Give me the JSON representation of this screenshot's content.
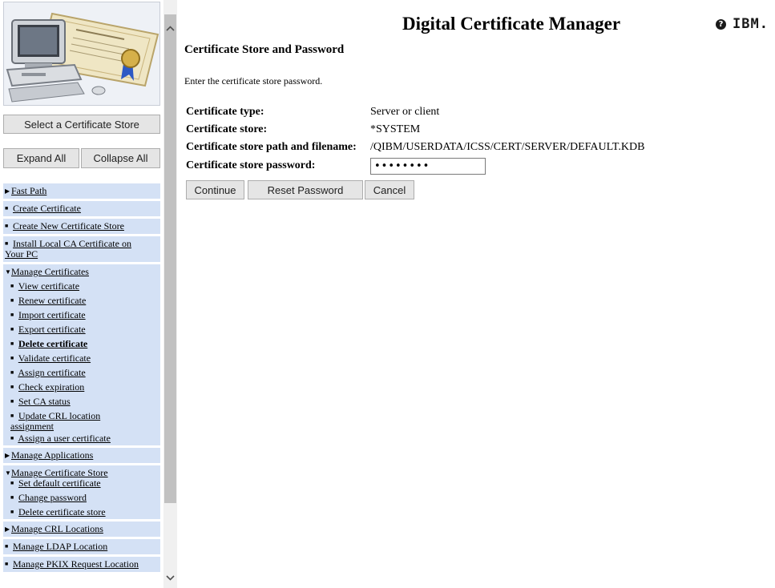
{
  "sidebar": {
    "select_store_label": "Select a Certificate Store",
    "expand_all_label": "Expand All",
    "collapse_all_label": "Collapse All",
    "fast_path": "Fast Path",
    "create_certificate": "Create Certificate",
    "create_new_store": "Create New Certificate Store",
    "install_local_ca_line1": "Install Local CA Certificate on",
    "install_local_ca_line2": "Your PC",
    "manage_certificates": {
      "label": "Manage Certificates",
      "items": [
        "View certificate",
        "Renew certificate",
        "Import certificate",
        "Export certificate",
        "Delete certificate",
        "Validate certificate",
        "Assign certificate",
        "Check expiration",
        "Set CA status",
        "Update CRL location",
        "assignment",
        "Assign a user certificate"
      ]
    },
    "manage_applications": "Manage Applications",
    "manage_store": {
      "label": "Manage Certificate Store",
      "items": [
        "Set default certificate",
        "Change password",
        "Delete certificate store"
      ]
    },
    "manage_crl": "Manage CRL Locations",
    "manage_ldap": "Manage LDAP Location",
    "manage_pkix": "Manage PKIX Request Location"
  },
  "header": {
    "title": "Digital Certificate Manager",
    "brand": "IBM."
  },
  "main": {
    "page_title": "Certificate Store and Password",
    "instructions": "Enter the certificate store password.",
    "fields": {
      "cert_type_label": "Certificate type:",
      "cert_type_value": "Server or client",
      "cert_store_label": "Certificate store:",
      "cert_store_value": "*SYSTEM",
      "path_label": "Certificate store path and filename:",
      "path_value": "/QIBM/USERDATA/ICSS/CERT/SERVER/DEFAULT.KDB",
      "password_label": "Certificate store password:",
      "password_value": "••••••••"
    },
    "buttons": {
      "continue": "Continue",
      "reset_password": "Reset Password",
      "cancel": "Cancel"
    }
  },
  "colors": {
    "nav_background": "#d4e1f5",
    "button_background": "#e5e5e5"
  }
}
